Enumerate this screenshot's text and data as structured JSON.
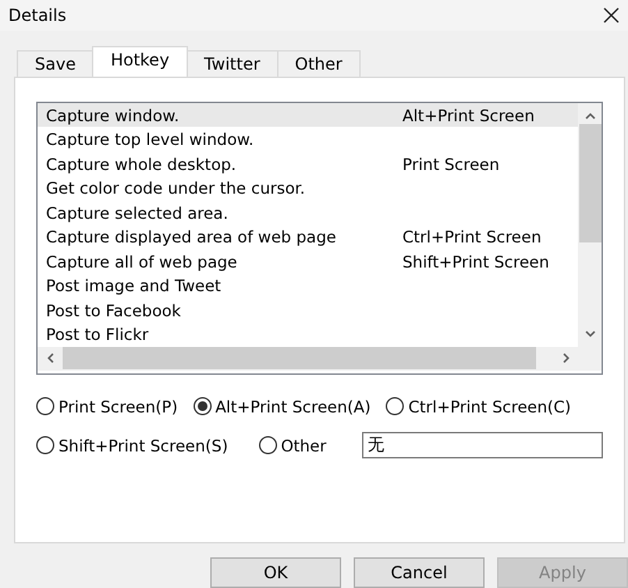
{
  "window": {
    "title": "Details"
  },
  "tabs": [
    {
      "label": "Save",
      "selected": false
    },
    {
      "label": "Hotkey",
      "selected": true
    },
    {
      "label": "Twitter",
      "selected": false
    },
    {
      "label": "Other",
      "selected": false
    }
  ],
  "actions": [
    {
      "name": "Capture window.",
      "hotkey": "Alt+Print Screen",
      "selected": true
    },
    {
      "name": "Capture top level window.",
      "selected": false
    },
    {
      "name": "Capture whole desktop.",
      "hotkey": "Print Screen",
      "selected": false
    },
    {
      "name": "Get color code under the cursor.",
      "selected": false
    },
    {
      "name": "Capture selected area.",
      "selected": false
    },
    {
      "name": "Capture displayed area of web page",
      "hotkey": "Ctrl+Print Screen",
      "selected": false
    },
    {
      "name": "Capture all of web page",
      "hotkey": "Shift+Print Screen",
      "selected": false
    },
    {
      "name": "Post image and Tweet",
      "selected": false
    },
    {
      "name": "Post to Facebook",
      "selected": false
    },
    {
      "name": "Post to Flickr",
      "selected": false
    }
  ],
  "hotkey_options": [
    [
      {
        "label": "Print Screen(P)",
        "selected": false
      },
      {
        "label": "Alt+Print Screen(A)",
        "selected": true
      },
      {
        "label": "Ctrl+Print Screen(C)",
        "selected": false
      }
    ],
    [
      {
        "label": "Shift+Print Screen(S)",
        "selected": false
      },
      {
        "label": "Other",
        "selected": false
      }
    ]
  ],
  "other_hotkey": {
    "value": "无"
  },
  "buttons": [
    {
      "label": "OK",
      "disabled": false
    },
    {
      "label": "Cancel",
      "disabled": false
    },
    {
      "label": "Apply",
      "disabled": true
    }
  ]
}
